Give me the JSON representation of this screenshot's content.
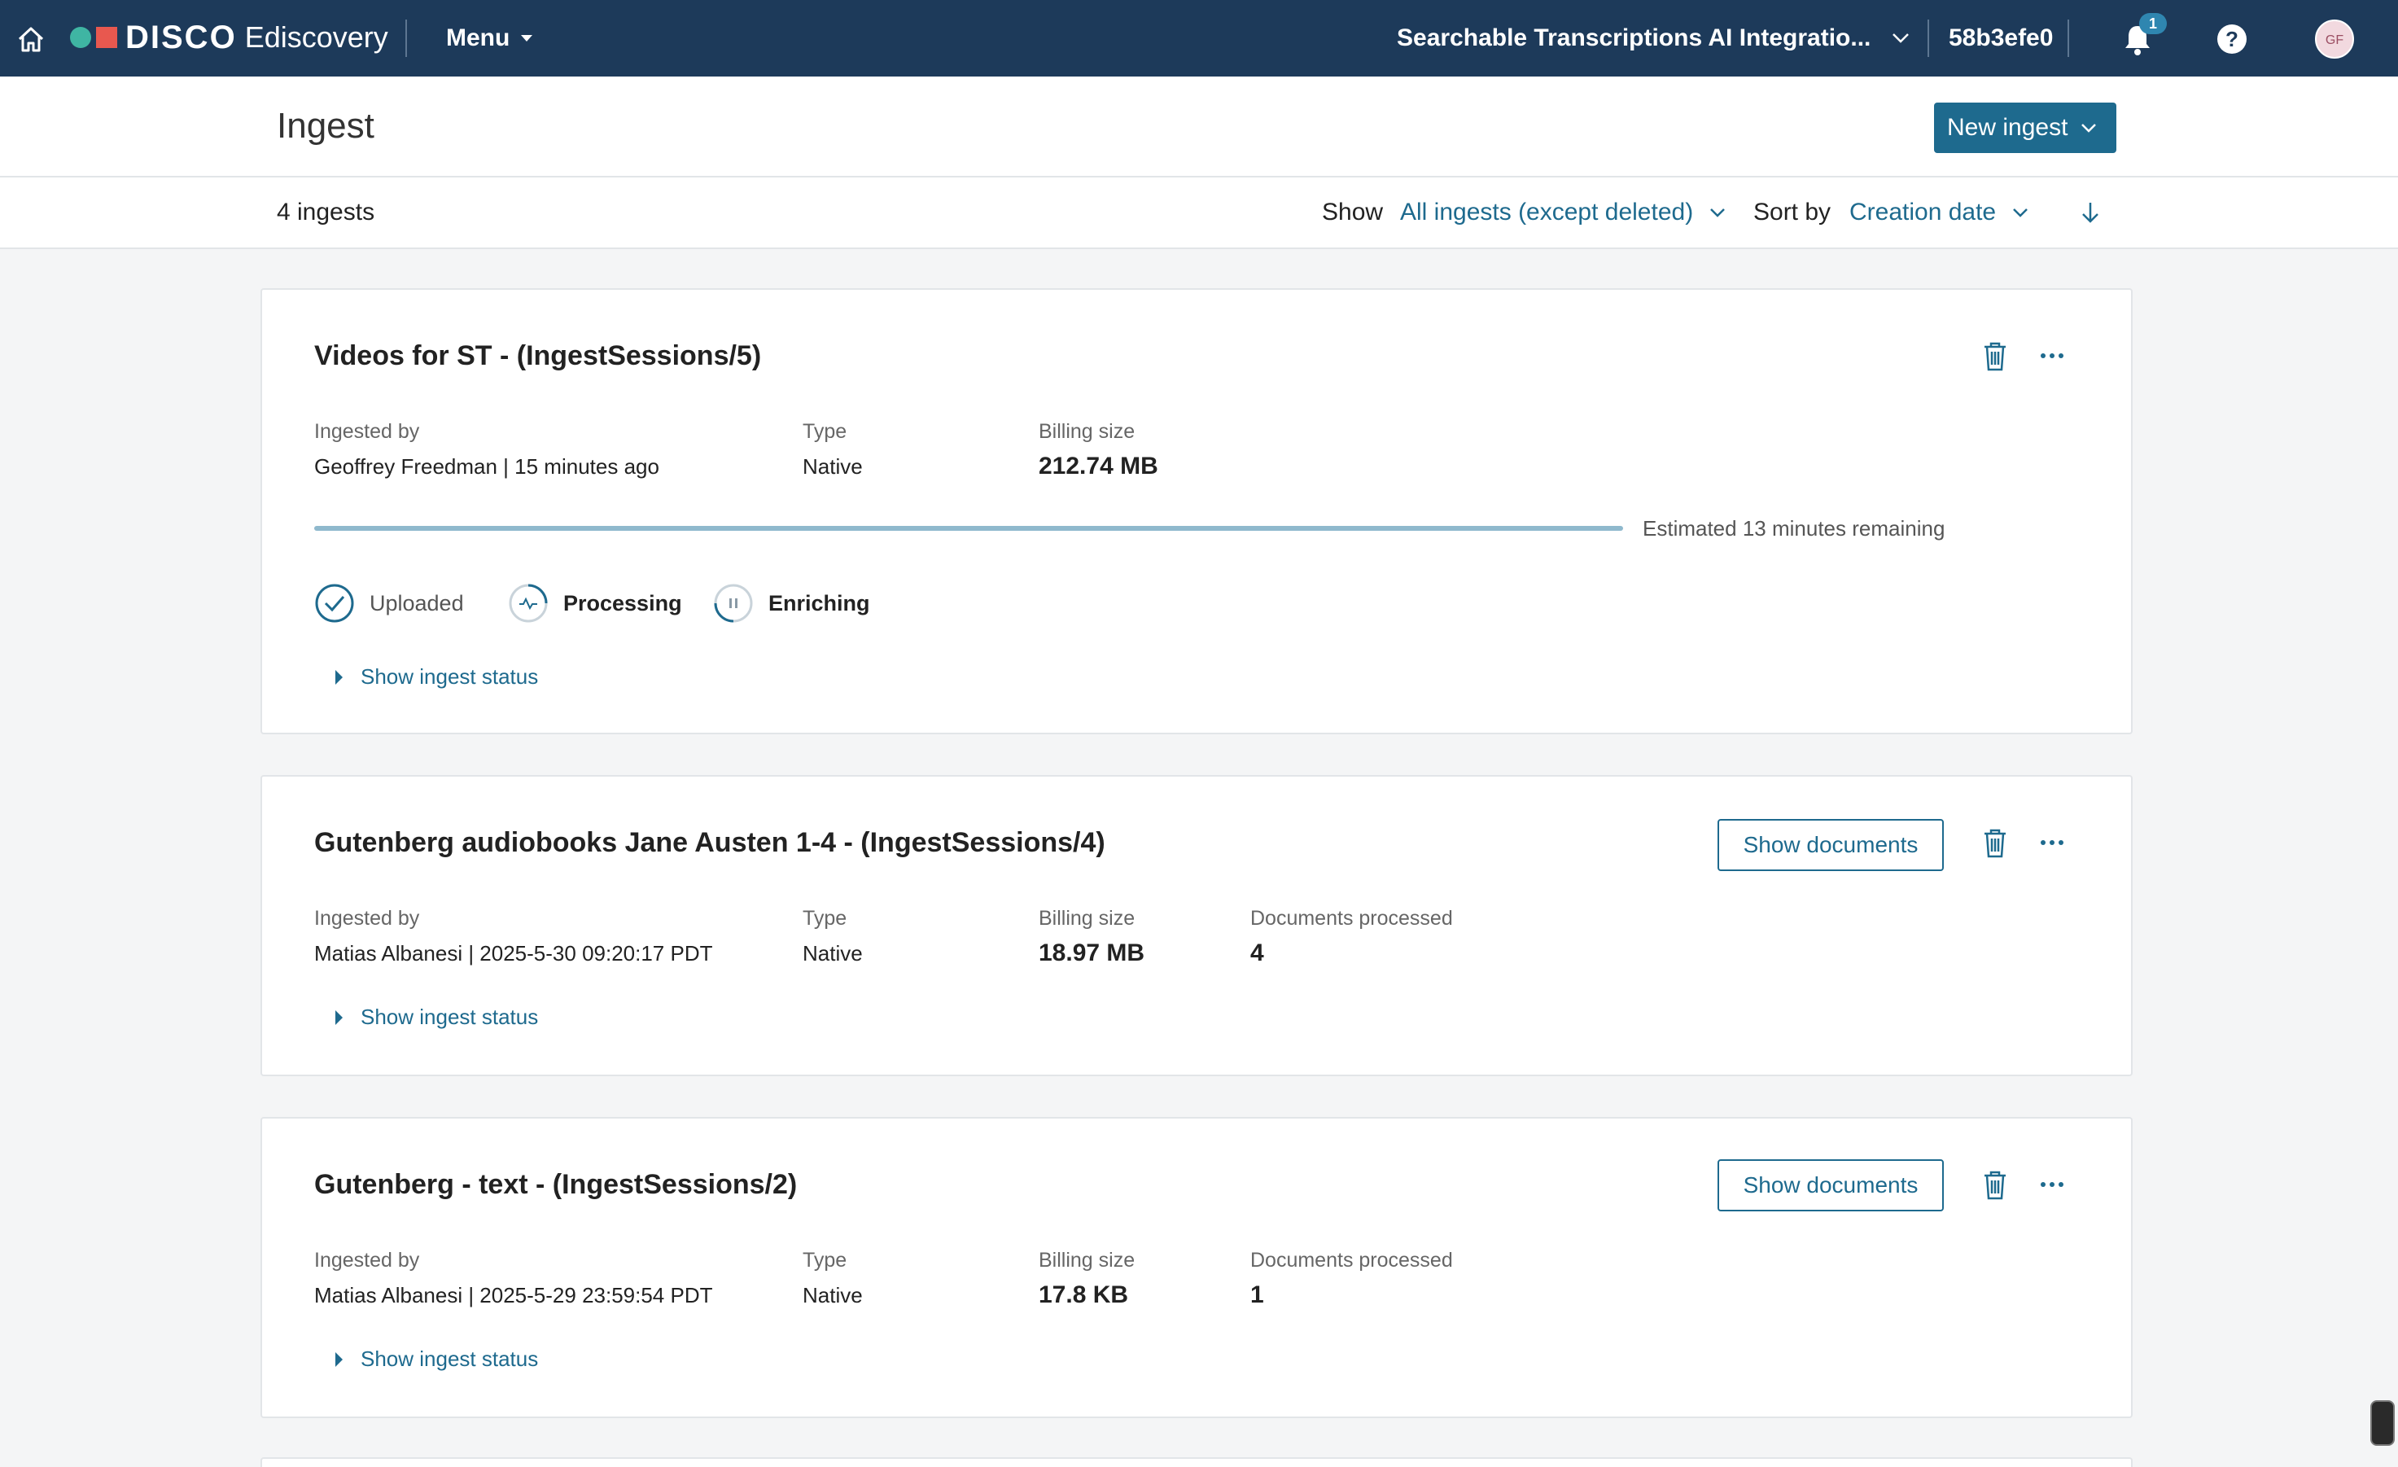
{
  "nav": {
    "brand": "DISCO",
    "product": "Ediscovery",
    "menu_label": "Menu",
    "project_name": "Searchable Transcriptions AI Integratio...",
    "case_id": "58b3efe0",
    "notification_count": "1",
    "help_glyph": "?",
    "avatar_initials": "GF",
    "icons": [
      "home-icon",
      "chevron-down-icon",
      "bell-icon",
      "help-icon"
    ]
  },
  "page": {
    "title": "Ingest",
    "new_button": "New ingest"
  },
  "filters": {
    "count": "4 ingests",
    "show_label": "Show",
    "show_value": "All ingests (except deleted)",
    "sort_label": "Sort by",
    "sort_value": "Creation date"
  },
  "ingests": [
    {
      "title": "Videos for ST - (IngestSessions/5)",
      "ingested_by_label": "Ingested by",
      "ingested_by": "Geoffrey Freedman  |  15 minutes ago",
      "type_label": "Type",
      "type": "Native",
      "billing_label": "Billing size",
      "billing_size": "212.74 MB",
      "progress": 1.0,
      "estimate": "Estimated 13 minutes remaining",
      "steps": [
        {
          "label": "Uploaded",
          "state": "done"
        },
        {
          "label": "Processing",
          "state": "active"
        },
        {
          "label": "Enriching",
          "state": "paused"
        }
      ],
      "show_status": "Show ingest status"
    },
    {
      "title": "Gutenberg audiobooks Jane Austen 1-4 - (IngestSessions/4)",
      "show_documents": "Show documents",
      "ingested_by_label": "Ingested by",
      "ingested_by": "Matias Albanesi  |  2025-5-30 09:20:17 PDT",
      "type_label": "Type",
      "type": "Native",
      "billing_label": "Billing size",
      "billing_size": "18.97 MB",
      "docs_label": "Documents processed",
      "docs": "4",
      "show_status": "Show ingest status"
    },
    {
      "title": "Gutenberg - text - (IngestSessions/2)",
      "show_documents": "Show documents",
      "ingested_by_label": "Ingested by",
      "ingested_by": "Matias Albanesi  |  2025-5-29 23:59:54 PDT",
      "type_label": "Type",
      "type": "Native",
      "billing_label": "Billing size",
      "billing_size": "17.8 KB",
      "docs_label": "Documents processed",
      "docs": "1",
      "show_status": "Show ingest status"
    }
  ],
  "colors": {
    "nav_bg": "#1d3a5a",
    "accent": "#1e6a8e",
    "progress": "#8fb9cd"
  }
}
